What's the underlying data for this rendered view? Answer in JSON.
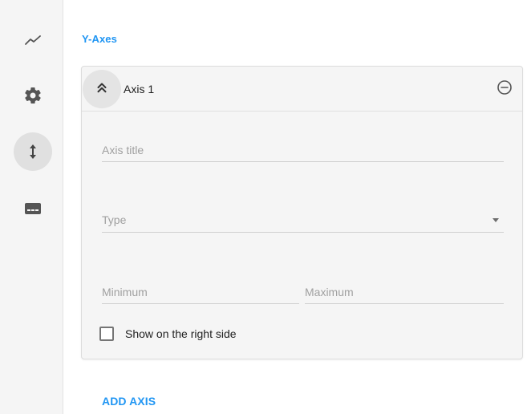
{
  "rail": {
    "items": [
      {
        "icon": "line-chart-icon",
        "active": false
      },
      {
        "icon": "gear-icon",
        "active": false
      },
      {
        "icon": "vertical-arrows-icon",
        "active": true
      },
      {
        "icon": "legend-icon",
        "active": false
      }
    ]
  },
  "section": {
    "title": "Y-Axes"
  },
  "axis": {
    "name": "Axis 1",
    "title_placeholder": "Axis title",
    "type_label": "Type",
    "min_placeholder": "Minimum",
    "max_placeholder": "Maximum",
    "right_side_label": "Show on the right side",
    "right_side_checked": false
  },
  "actions": {
    "add_axis_label": "ADD AXIS"
  },
  "colors": {
    "accent": "#2196f3",
    "rail_bg": "#f5f5f5",
    "card_bg": "#f5f5f5"
  }
}
